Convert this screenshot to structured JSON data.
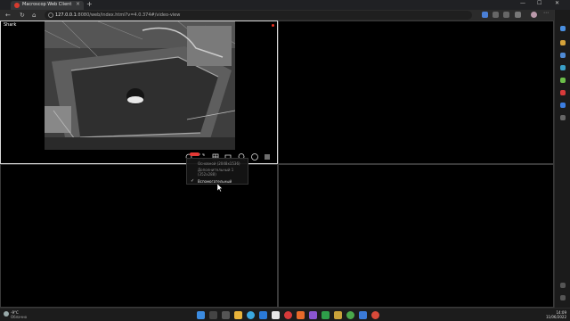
{
  "browser": {
    "tab_title": "Macroscop Web Client",
    "url_host": "127.0.0.1",
    "url_rest": ":8080/web/index.html?v=4.0.374#/video-view",
    "new_tab_label": "+",
    "tab_close_label": "×",
    "window_controls": [
      "—",
      "☐",
      "✕"
    ],
    "nav": [
      "←",
      "↻",
      "⌂"
    ]
  },
  "camera": {
    "name": "Shark",
    "quality_menu": {
      "items": [
        {
          "label": "Основной (2048x1536)",
          "selected": false
        },
        {
          "label": "Дополнительный 1",
          "selected": false
        },
        {
          "label": "(352x288)",
          "selected": false
        },
        {
          "label": "Вспомогательный",
          "selected": true
        }
      ],
      "check_mark": "✓"
    }
  },
  "taskbar": {
    "weather_temp": "-9°C",
    "weather_desc": "Облачно",
    "time": "14:09",
    "date": "11/06/2022"
  },
  "colors": {
    "accent_red": "#e53935",
    "selection_border": "#d8d8d8"
  }
}
